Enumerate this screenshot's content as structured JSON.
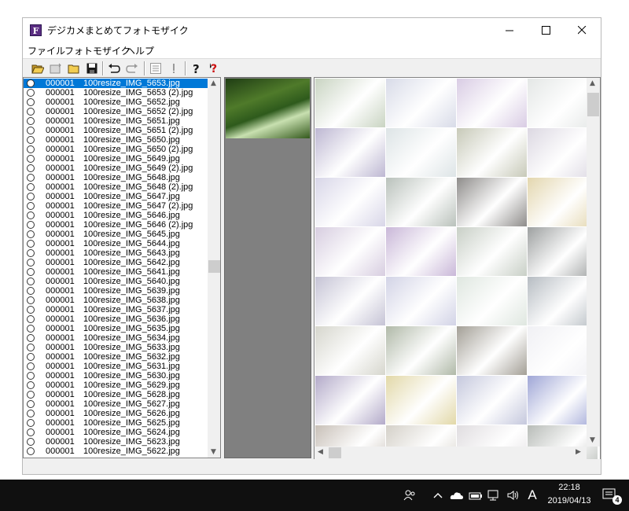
{
  "window": {
    "title": "デジカメまとめてフォトモザイク",
    "app_icon_letter": "F"
  },
  "menu": [
    "ファイル",
    "フォトモザイク",
    "ヘルプ"
  ],
  "toolbar": {
    "icons": [
      "open-folder-icon",
      "new-image-icon",
      "folder-icon",
      "save-icon",
      "undo-icon",
      "redo-icon",
      "list-icon",
      "exclamation-icon",
      "help-icon",
      "context-help-icon"
    ]
  },
  "file_list": {
    "selected_index": 0,
    "items": [
      {
        "num": "000001",
        "name": "100resize_IMG_5653.jpg"
      },
      {
        "num": "000001",
        "name": "100resize_IMG_5653 (2).jpg"
      },
      {
        "num": "000001",
        "name": "100resize_IMG_5652.jpg"
      },
      {
        "num": "000001",
        "name": "100resize_IMG_5652 (2).jpg"
      },
      {
        "num": "000001",
        "name": "100resize_IMG_5651.jpg"
      },
      {
        "num": "000001",
        "name": "100resize_IMG_5651 (2).jpg"
      },
      {
        "num": "000001",
        "name": "100resize_IMG_5650.jpg"
      },
      {
        "num": "000001",
        "name": "100resize_IMG_5650 (2).jpg"
      },
      {
        "num": "000001",
        "name": "100resize_IMG_5649.jpg"
      },
      {
        "num": "000001",
        "name": "100resize_IMG_5649 (2).jpg"
      },
      {
        "num": "000001",
        "name": "100resize_IMG_5648.jpg"
      },
      {
        "num": "000001",
        "name": "100resize_IMG_5648 (2).jpg"
      },
      {
        "num": "000001",
        "name": "100resize_IMG_5647.jpg"
      },
      {
        "num": "000001",
        "name": "100resize_IMG_5647 (2).jpg"
      },
      {
        "num": "000001",
        "name": "100resize_IMG_5646.jpg"
      },
      {
        "num": "000001",
        "name": "100resize_IMG_5646 (2).jpg"
      },
      {
        "num": "000001",
        "name": "100resize_IMG_5645.jpg"
      },
      {
        "num": "000001",
        "name": "100resize_IMG_5644.jpg"
      },
      {
        "num": "000001",
        "name": "100resize_IMG_5643.jpg"
      },
      {
        "num": "000001",
        "name": "100resize_IMG_5642.jpg"
      },
      {
        "num": "000001",
        "name": "100resize_IMG_5641.jpg"
      },
      {
        "num": "000001",
        "name": "100resize_IMG_5640.jpg"
      },
      {
        "num": "000001",
        "name": "100resize_IMG_5639.jpg"
      },
      {
        "num": "000001",
        "name": "100resize_IMG_5638.jpg"
      },
      {
        "num": "000001",
        "name": "100resize_IMG_5637.jpg"
      },
      {
        "num": "000001",
        "name": "100resize_IMG_5636.jpg"
      },
      {
        "num": "000001",
        "name": "100resize_IMG_5635.jpg"
      },
      {
        "num": "000001",
        "name": "100resize_IMG_5634.jpg"
      },
      {
        "num": "000001",
        "name": "100resize_IMG_5633.jpg"
      },
      {
        "num": "000001",
        "name": "100resize_IMG_5632.jpg"
      },
      {
        "num": "000001",
        "name": "100resize_IMG_5631.jpg"
      },
      {
        "num": "000001",
        "name": "100resize_IMG_5630.jpg"
      },
      {
        "num": "000001",
        "name": "100resize_IMG_5629.jpg"
      },
      {
        "num": "000001",
        "name": "100resize_IMG_5628.jpg"
      },
      {
        "num": "000001",
        "name": "100resize_IMG_5627.jpg"
      },
      {
        "num": "000001",
        "name": "100resize_IMG_5626.jpg"
      },
      {
        "num": "000001",
        "name": "100resize_IMG_5625.jpg"
      },
      {
        "num": "000001",
        "name": "100resize_IMG_5624.jpg"
      },
      {
        "num": "000001",
        "name": "100resize_IMG_5623.jpg"
      },
      {
        "num": "000001",
        "name": "100resize_IMG_5622.jpg"
      }
    ]
  },
  "mosaic": {
    "tiles": [
      "#c9d4c2",
      "#d8dbe8",
      "#d9cce4",
      "#e4e7e6",
      "#bdb7d2",
      "#dde4e6",
      "#c7c9b8",
      "#dcd8e2",
      "#d8d6e8",
      "#b9c1bb",
      "#8e8c8a",
      "#e3d6ae",
      "#d7cde0",
      "#c9b7d8",
      "#c8cfc6",
      "#9da0a0",
      "#c5c3d5",
      "#d2d3e6",
      "#dfe7e0",
      "#b6bcc2",
      "#d6d6cd",
      "#b0b9a8",
      "#a39f96",
      "#f0f0f4",
      "#b3aac9",
      "#e2d8a8",
      "#c5c8dd",
      "#9fa6d6",
      "#c8c0b8",
      "#d4d0c8",
      "#e0dde0",
      "#b8bcb8"
    ]
  },
  "taskbar": {
    "time": "22:18",
    "date": "2019/04/13",
    "ime": "A",
    "notifications": "4",
    "icons": [
      "people-icon",
      "chevron-up-icon",
      "onedrive-icon",
      "battery-icon",
      "network-icon",
      "volume-icon"
    ]
  },
  "colors": {
    "selection": "#0078d7",
    "taskbar": "#101010"
  }
}
